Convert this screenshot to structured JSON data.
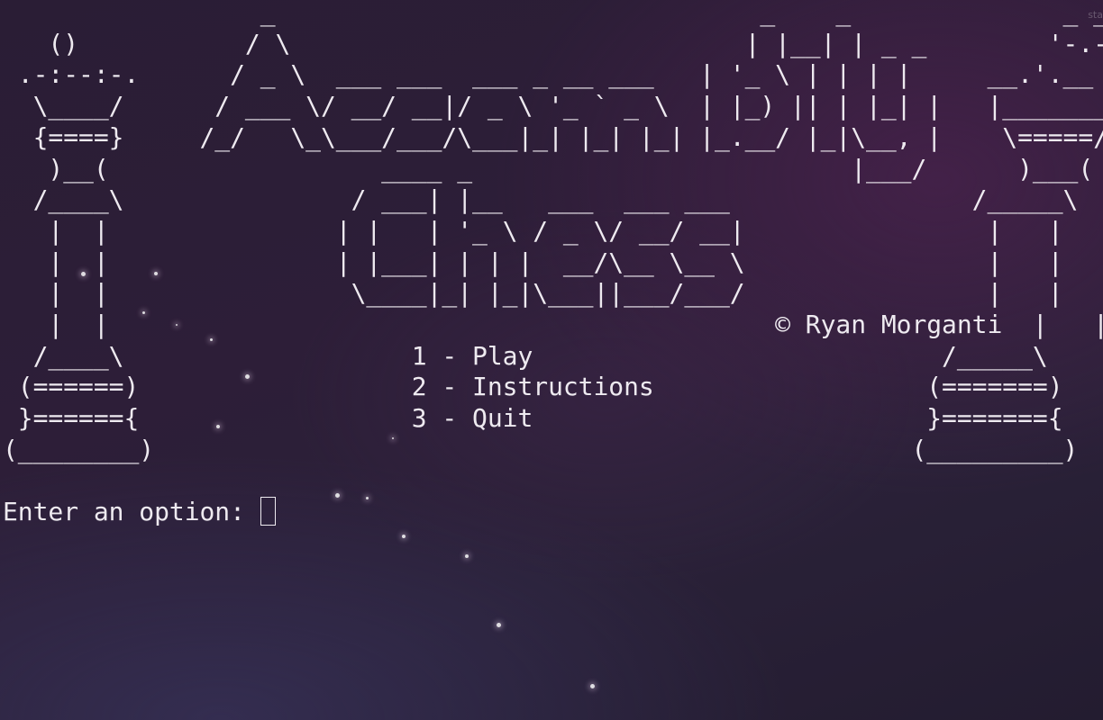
{
  "corner_text": "sta",
  "ascii_art": [
    "                 _                                _    _              _ _ ",
    "   ()           / \\                              | |__| | _ _        '-.-' ",
    " .-:--:-.      / _ \\  ___ ___  ___ _ __ ___   | '_ \\ | | | |     __.'.__ ",
    "  \\____/      / ___ \\/ __/ __|/ _ \\ '_ ` _ \\  | |_) || | |_| |   |_______| ",
    "  {====}     /_/   \\_\\___/___/\\___|_| |_| |_| |_.__/ |_|\\__, |    \\=====/ ",
    "   )__(                  ____ _                         |___/      )___( ",
    "  /____\\               / ___| |__   ___  ___ ___                /_____\\ ",
    "   |  |               | |   | '_ \\ / _ \\/ __/ __|                |   | ",
    "   |  |               | |___| | | |  __/\\__ \\__ \\                |   | ",
    "   |  |                \\____|_| |_|\\___||___/___/                |   | ",
    "   |  |                                            © Ryan Morganti  |   | ",
    "  /____\\                   1 - Play                           /_____\\ ",
    " (======)                  2 - Instructions                  (=======) ",
    " }======{                  3 - Quit                          }======={ ",
    "(________)                                                  (_________) ",
    "",
    "Enter an option: "
  ],
  "credit": "© Ryan Morganti",
  "menu": {
    "play": "1 - Play",
    "instructions": "2 - Instructions",
    "quit": "3 - Quit"
  },
  "prompt": "Enter an option: "
}
